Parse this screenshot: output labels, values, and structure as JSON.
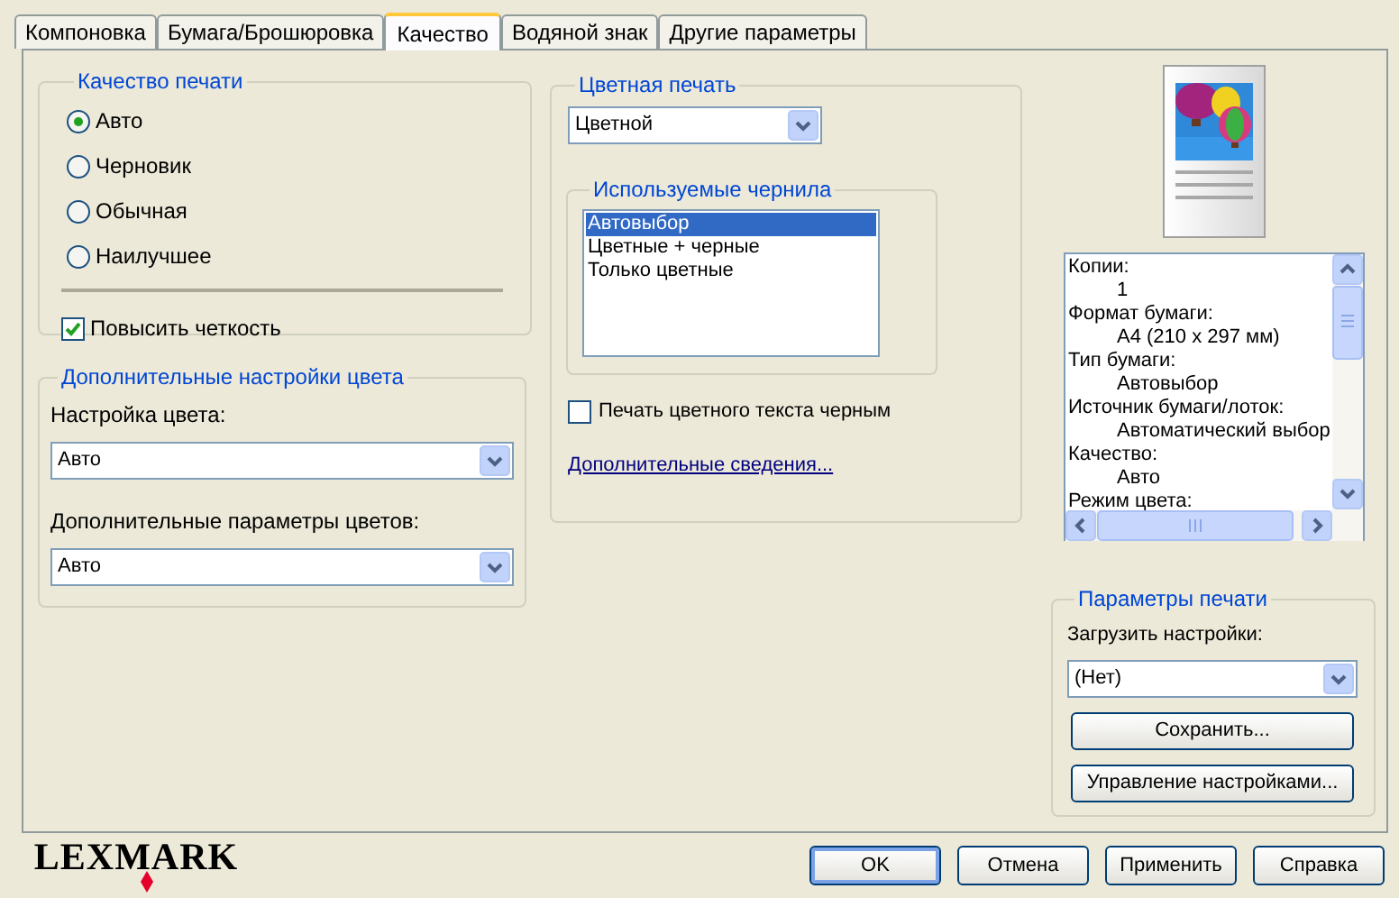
{
  "tabs": [
    {
      "label": "Компоновка",
      "selected": false
    },
    {
      "label": "Бумага/Брошюровка",
      "selected": false
    },
    {
      "label": "Качество",
      "selected": true
    },
    {
      "label": "Водяной знак",
      "selected": false
    },
    {
      "label": "Другие параметры",
      "selected": false
    }
  ],
  "print_quality": {
    "title": "Качество печати",
    "options": [
      {
        "label": "Авто",
        "selected": true
      },
      {
        "label": "Черновик",
        "selected": false
      },
      {
        "label": "Обычная",
        "selected": false
      },
      {
        "label": "Наилучшее",
        "selected": false
      }
    ],
    "sharpen": {
      "label": "Повысить четкость",
      "checked": true
    }
  },
  "color_settings": {
    "title": "Дополнительные настройки цвета",
    "fields": [
      {
        "label": "Настройка цвета:",
        "value": "Авто"
      },
      {
        "label": "Дополнительные параметры цветов:",
        "value": "Авто"
      }
    ]
  },
  "color_print": {
    "title": "Цветная печать",
    "value": "Цветной",
    "inks": {
      "title": "Используемые чернила",
      "items": [
        {
          "label": "Автовыбор",
          "selected": true
        },
        {
          "label": "Цветные + черные",
          "selected": false
        },
        {
          "label": "Только цветные",
          "selected": false
        }
      ]
    },
    "black_text": {
      "label": "Печать цветного текста черным",
      "checked": false
    },
    "link": "Дополнительные сведения..."
  },
  "summary": [
    {
      "text": "Копии:",
      "kind": "heading"
    },
    {
      "text": "1",
      "kind": "value"
    },
    {
      "text": "Формат бумаги:",
      "kind": "heading"
    },
    {
      "text": "A4 (210 x 297 мм)",
      "kind": "value"
    },
    {
      "text": "Тип бумаги:",
      "kind": "heading"
    },
    {
      "text": "Автовыбор",
      "kind": "value"
    },
    {
      "text": "Источник бумаги/лоток:",
      "kind": "heading"
    },
    {
      "text": "Автоматический выбор",
      "kind": "value"
    },
    {
      "text": "Качество:",
      "kind": "heading"
    },
    {
      "text": "Авто",
      "kind": "value"
    },
    {
      "text": "Режим цвета:",
      "kind": "heading"
    }
  ],
  "print_settings": {
    "title": "Параметры печати",
    "load_label": "Загрузить настройки:",
    "load_value": "(Нет)",
    "buttons": [
      "Сохранить...",
      "Управление настройками..."
    ]
  },
  "logo": "LEXMARK",
  "buttons": [
    {
      "label": "OK",
      "default": true
    },
    {
      "label": "Отмена",
      "default": false
    },
    {
      "label": "Применить",
      "default": false
    },
    {
      "label": "Справка",
      "default": false
    }
  ]
}
